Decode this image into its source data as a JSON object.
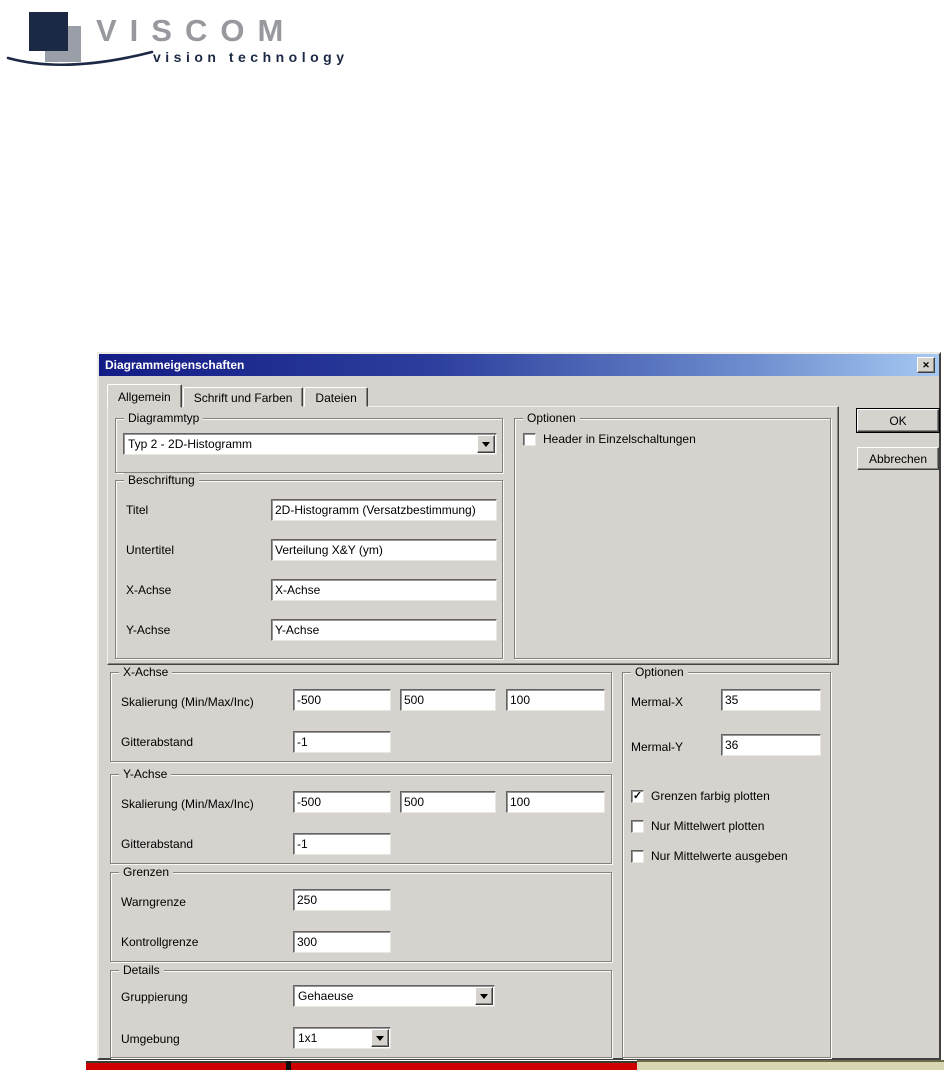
{
  "logo": {
    "brand": "VISCOM",
    "tagline": "vision technology"
  },
  "icons": {
    "close": "✕",
    "dropdown_arrow": "dropdown-arrow",
    "checkmark": "✓"
  },
  "colors": {
    "titlebar_from": "#131c86",
    "titlebar_to": "#a6c8f2",
    "dialog_bg": "#d6d3ce",
    "logo_navy": "#1c2945",
    "logo_gray": "#9a9ea6",
    "red_bar": "#cc0000",
    "khaki_bar": "#d9d6b2"
  },
  "dialog": {
    "title": "Diagrammeigenschaften",
    "tabs": [
      {
        "label": "Allgemein"
      },
      {
        "label": "Schrift und Farben"
      },
      {
        "label": "Dateien"
      }
    ],
    "ok_label": "OK",
    "cancel_label": "Abbrechen",
    "diagrammtyp": {
      "label": "Diagrammtyp",
      "value": "Typ 2 - 2D-Histogramm"
    },
    "optionen_top": {
      "label": "Optionen",
      "checkbox_label": "Header in Einzelschaltungen",
      "checkbox_mark": ""
    },
    "beschriftung": {
      "label": "Beschriftung",
      "fields": [
        {
          "label": "Titel",
          "value": "2D-Histogramm (Versatzbestimmung)"
        },
        {
          "label": "Untertitel",
          "value": "Verteilung X&Y (ym)"
        },
        {
          "label": "X-Achse",
          "value": "X-Achse"
        },
        {
          "label": "Y-Achse",
          "value": "Y-Achse"
        }
      ]
    },
    "x_achse": {
      "label": "X-Achse",
      "skalierung_label": "Skalierung (Min/Max/Inc)",
      "min": "-500",
      "max": "500",
      "inc": "100",
      "gitter_label": "Gitterabstand",
      "gitter": "-1"
    },
    "y_achse": {
      "label": "Y-Achse",
      "skalierung_label": "Skalierung (Min/Max/Inc)",
      "min": "-500",
      "max": "500",
      "inc": "100",
      "gitter_label": "Gitterabstand",
      "gitter": "-1"
    },
    "grenzen": {
      "label": "Grenzen",
      "warn_label": "Warngrenze",
      "warn": "250",
      "kontroll_label": "Kontrollgrenze",
      "kontroll": "300"
    },
    "details": {
      "label": "Details",
      "gruppierung_label": "Gruppierung",
      "gruppierung_value": "Gehaeuse",
      "umgebung_label": "Umgebung",
      "umgebung_value": "1x1"
    },
    "optionen_right": {
      "label": "Optionen",
      "mermal_x_label": "Mermal-X",
      "mermal_x": "35",
      "mermal_y_label": "Mermal-Y",
      "mermal_y": "36",
      "checkboxes": [
        {
          "label": "Grenzen farbig plotten",
          "mark": "✓"
        },
        {
          "label": "Nur Mittelwert plotten",
          "mark": ""
        },
        {
          "label": "Nur Mittelwerte ausgeben",
          "mark": ""
        }
      ]
    }
  }
}
